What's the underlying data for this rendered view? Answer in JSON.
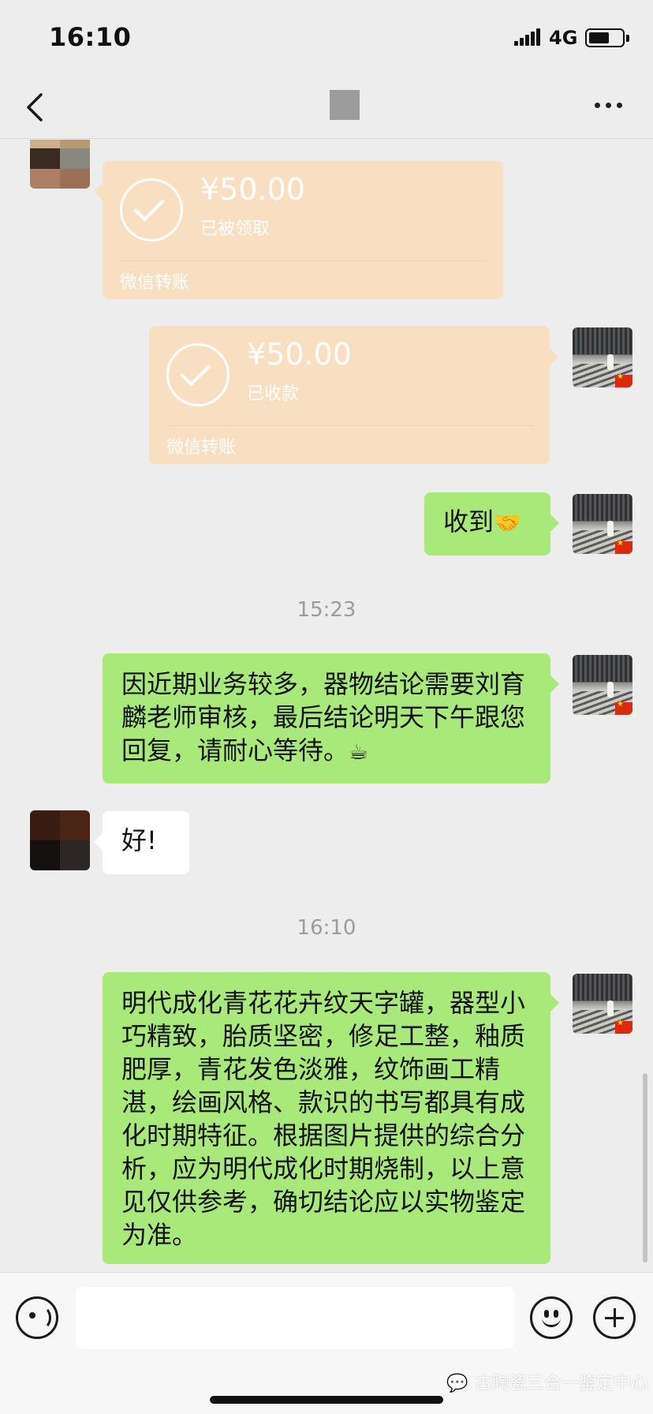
{
  "status_bar": {
    "time": "16:10",
    "network": "4G",
    "battery_level": 0.62
  },
  "nav": {
    "back_icon": "chevron-left-icon",
    "more_icon": "more-dots-icon"
  },
  "messages": [
    {
      "type": "transfer",
      "side": "left",
      "amount": "¥50.00",
      "status": "已被领取",
      "label": "微信转账"
    },
    {
      "type": "transfer",
      "side": "right",
      "amount": "¥50.00",
      "status": "已收款",
      "label": "微信转账"
    },
    {
      "type": "text",
      "side": "right",
      "text": "收到",
      "emoji": "🤝"
    },
    {
      "type": "timestamp",
      "text": "15:23"
    },
    {
      "type": "text",
      "side": "right",
      "text": "因近期业务较多，器物结论需要刘育麟老师审核，最后结论明天下午跟您回复，请耐心等待。",
      "emoji": "☕"
    },
    {
      "type": "text",
      "side": "left",
      "text": "好!"
    },
    {
      "type": "timestamp",
      "text": "16:10"
    },
    {
      "type": "text",
      "side": "right",
      "text": "明代成化青花花卉纹天字罐，器型小巧精致，胎质坚密，修足工整，釉质肥厚，青花发色淡雅，纹饰画工精湛，绘画风格、款识的书写都具有成化时期特征。根据图片提供的综合分析，应为明代成化时期烧制，以上意见仅供参考，确切结论应以实物鉴定为准。"
    }
  ],
  "input_bar": {
    "voice_icon": "voice-icon",
    "emoji_icon": "emoji-icon",
    "add_icon": "plus-icon",
    "watermark": "古陶瓷三合一鉴定中心"
  },
  "colors": {
    "background": "#ededed",
    "sent_bubble": "#a9e97a",
    "received_bubble": "#ffffff",
    "transfer_bubble": "#f8dfc2"
  }
}
